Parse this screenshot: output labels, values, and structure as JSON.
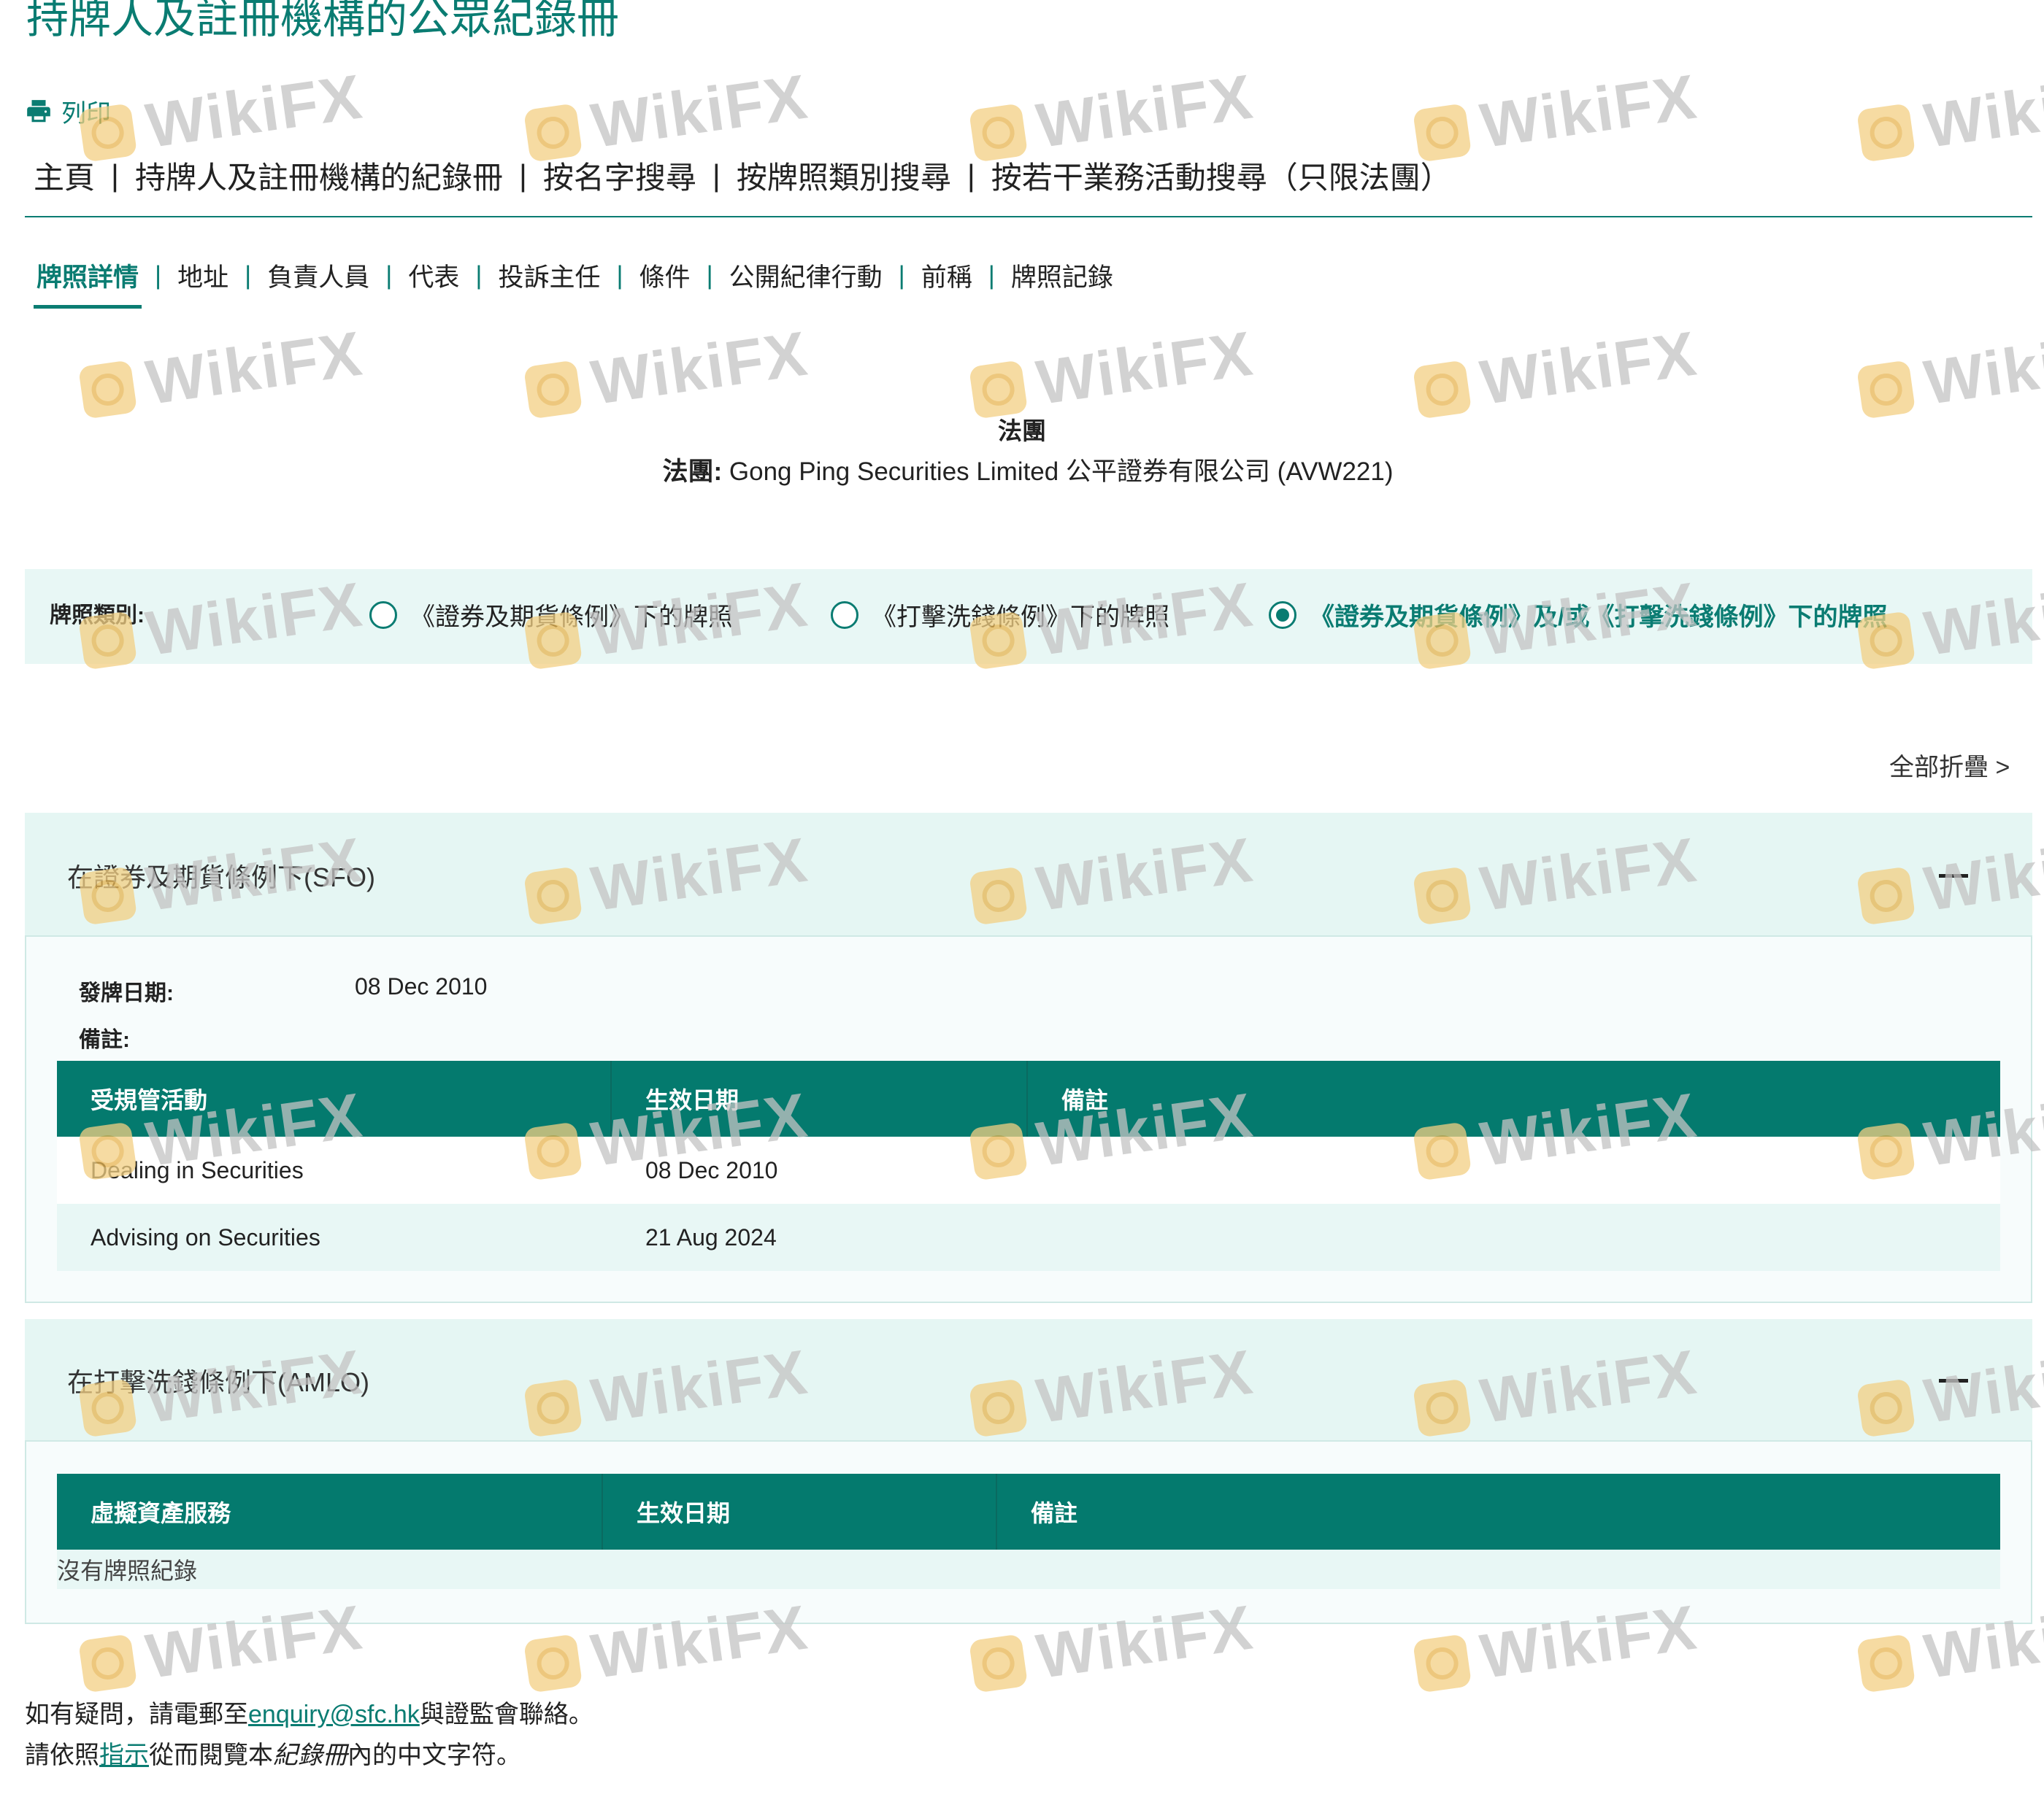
{
  "page": {
    "title": "持牌人及註冊機構的公眾紀錄冊",
    "print_label": "列印"
  },
  "top_nav": [
    "主頁",
    "持牌人及註冊機構的紀錄冊",
    "按名字搜尋",
    "按牌照類別搜尋",
    "按若干業務活動搜尋（只限法團）"
  ],
  "sub_nav": {
    "active": "牌照詳情",
    "items": [
      "地址",
      "負責人員",
      "代表",
      "投訴主任",
      "條件",
      "公開紀律行動",
      "前稱",
      "牌照記錄"
    ]
  },
  "entity": {
    "type": "法團",
    "name_label": "法團:",
    "name": "Gong Ping Securities Limited 公平證券有限公司 (AVW221)"
  },
  "license_type": {
    "label": "牌照類別:",
    "options": [
      "《證券及期貨條例》下的牌照",
      "《打擊洗錢條例》下的牌照",
      "《證券及期貨條例》及/或《打擊洗錢條例》下的牌照"
    ],
    "selected_index": 2
  },
  "collapse_all": "全部折疊 >",
  "sfo": {
    "title": "在證券及期貨條例下(SFO)",
    "issue_date_label": "發牌日期:",
    "issue_date": "08 Dec 2010",
    "remarks_label": "備註:",
    "columns": [
      "受規管活動",
      "生效日期",
      "備註"
    ],
    "rows": [
      [
        "Dealing in Securities",
        "08 Dec 2010",
        ""
      ],
      [
        "Advising on Securities",
        "21 Aug 2024",
        ""
      ]
    ]
  },
  "amlo": {
    "title": "在打擊洗錢條例下(AMLO)",
    "columns": [
      "虛擬資產服務",
      "生效日期",
      "備註"
    ],
    "empty_text": "沒有牌照紀錄"
  },
  "footer": {
    "line1_prefix": "如有疑問，請電郵至",
    "email": "enquiry@sfc.hk",
    "line1_suffix": "與證監會聯絡。",
    "line2_prefix": "請依照",
    "guide_link": "指示",
    "line2_mid": "從而閱覽本",
    "register_italic": "紀錄冊",
    "line2_suffix": "內的中文字符。"
  },
  "watermark": {
    "text": "WikiFX"
  },
  "colors": {
    "accent": "#047a6e",
    "tint": "#e8f7f5"
  }
}
